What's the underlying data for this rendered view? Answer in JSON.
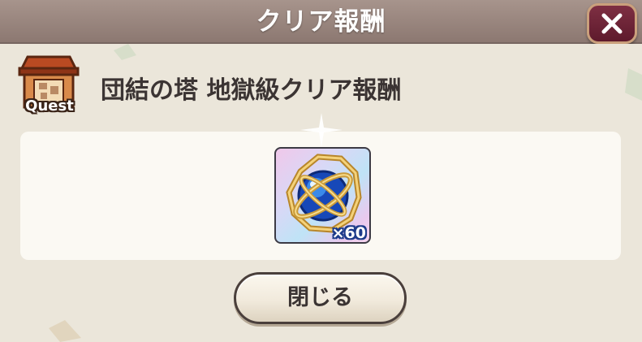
{
  "dialog": {
    "title": "クリア報酬",
    "close_icon": "close-x-icon"
  },
  "quest": {
    "icon": "quest-house-icon",
    "icon_label": "Quest",
    "title": "団結の塔 地獄級クリア報酬"
  },
  "reward": {
    "item_icon": "armillary-sphere-orb-icon",
    "quantity": "×60"
  },
  "actions": {
    "close_label": "閉じる"
  },
  "colors": {
    "header": "#9b8880",
    "close_button": "#6e2538",
    "panel": "#fbf9f3",
    "background": "#ebe6da"
  }
}
